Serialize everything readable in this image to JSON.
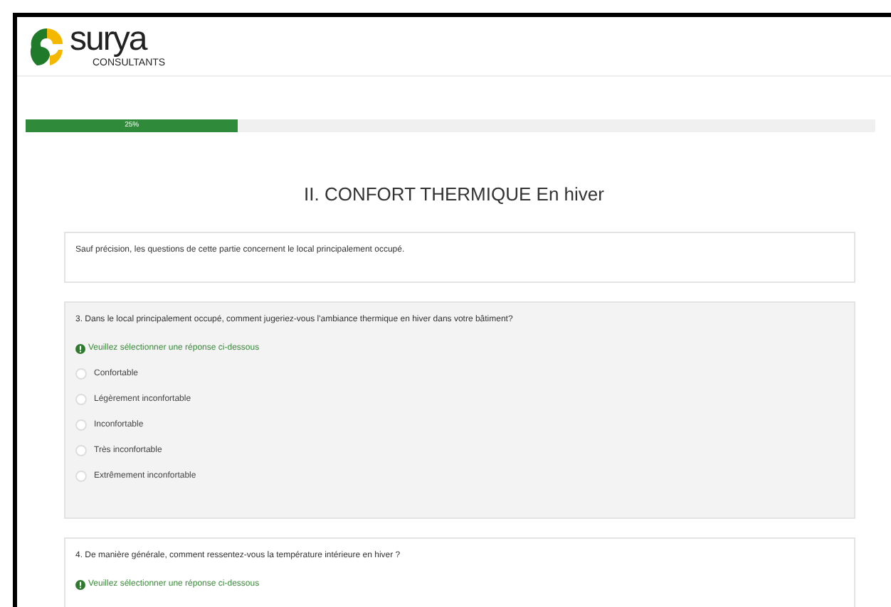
{
  "logo": {
    "name": "surya",
    "tagline": "CONSULTANTS"
  },
  "progress": {
    "level": 0.25,
    "label": "25%"
  },
  "section_title": "II. CONFORT THERMIQUE En hiver",
  "note": "Sauf précision, les questions de cette partie concernent le local principalement occupé.",
  "questions": [
    {
      "text": "3. Dans le local principalement occupé, comment jugeriez-vous l'ambiance thermique en hiver dans votre bâtiment?",
      "active": true,
      "hint": "Veuillez sélectionner une réponse ci-dessous",
      "options": [
        {
          "label": "Confortable",
          "selected": false
        },
        {
          "label": "Légèrement inconfortable",
          "selected": false
        },
        {
          "label": "Inconfortable",
          "selected": false
        },
        {
          "label": "Très inconfortable",
          "selected": false
        },
        {
          "label": "Extrêmement inconfortable",
          "selected": false
        }
      ]
    },
    {
      "text": "4. De manière générale, comment ressentez-vous la température intérieure en hiver ?",
      "active": false,
      "hint": "Veuillez sélectionner une réponse ci-dessous"
    }
  ]
}
